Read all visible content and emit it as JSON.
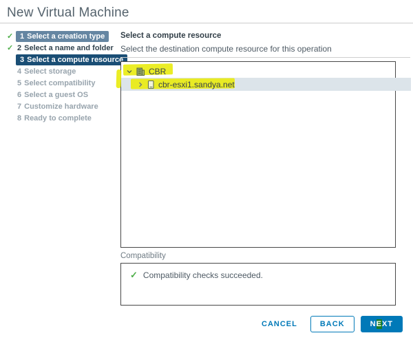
{
  "window": {
    "title": "New Virtual Machine"
  },
  "sidebar": {
    "steps": [
      {
        "num": "1",
        "label": "Select a creation type",
        "status": "completed"
      },
      {
        "num": "2",
        "label": "Select a name and folder",
        "status": "completed"
      },
      {
        "num": "3",
        "label": "Select a compute resource",
        "status": "current"
      },
      {
        "num": "4",
        "label": "Select storage",
        "status": "upcoming"
      },
      {
        "num": "5",
        "label": "Select compatibility",
        "status": "upcoming"
      },
      {
        "num": "6",
        "label": "Select a guest OS",
        "status": "upcoming"
      },
      {
        "num": "7",
        "label": "Customize hardware",
        "status": "upcoming"
      },
      {
        "num": "8",
        "label": "Ready to complete",
        "status": "upcoming"
      }
    ]
  },
  "main": {
    "heading": "Select a compute resource",
    "subheading": "Select the destination compute resource for this operation",
    "tree": {
      "nodes": [
        {
          "label": "CBR",
          "type": "datacenter",
          "expanded": true,
          "selected": false,
          "annotation": "yellow-highlight"
        },
        {
          "label": "cbr-esxi1.sandya.net",
          "type": "host",
          "expanded": false,
          "selected": true,
          "annotation": "yellow-highlight"
        }
      ]
    },
    "compatibility": {
      "label": "Compatibility",
      "message": "Compatibility checks succeeded.",
      "status_icon": "check-icon"
    }
  },
  "footer": {
    "cancel_label": "CANCEL",
    "back_label": "BACK",
    "next_label": "NEXT",
    "next_parts": {
      "pre": "N",
      "cursor": "E",
      "post": "XT"
    }
  },
  "colors": {
    "accent_blue": "#0079b8",
    "step_current_bg": "#1a4e75",
    "step_completed_badge_bg": "#6586a2",
    "check_green": "#4eae49",
    "selected_row_bg": "#dce4ea",
    "annotation_yellow": "#e9eb12"
  }
}
